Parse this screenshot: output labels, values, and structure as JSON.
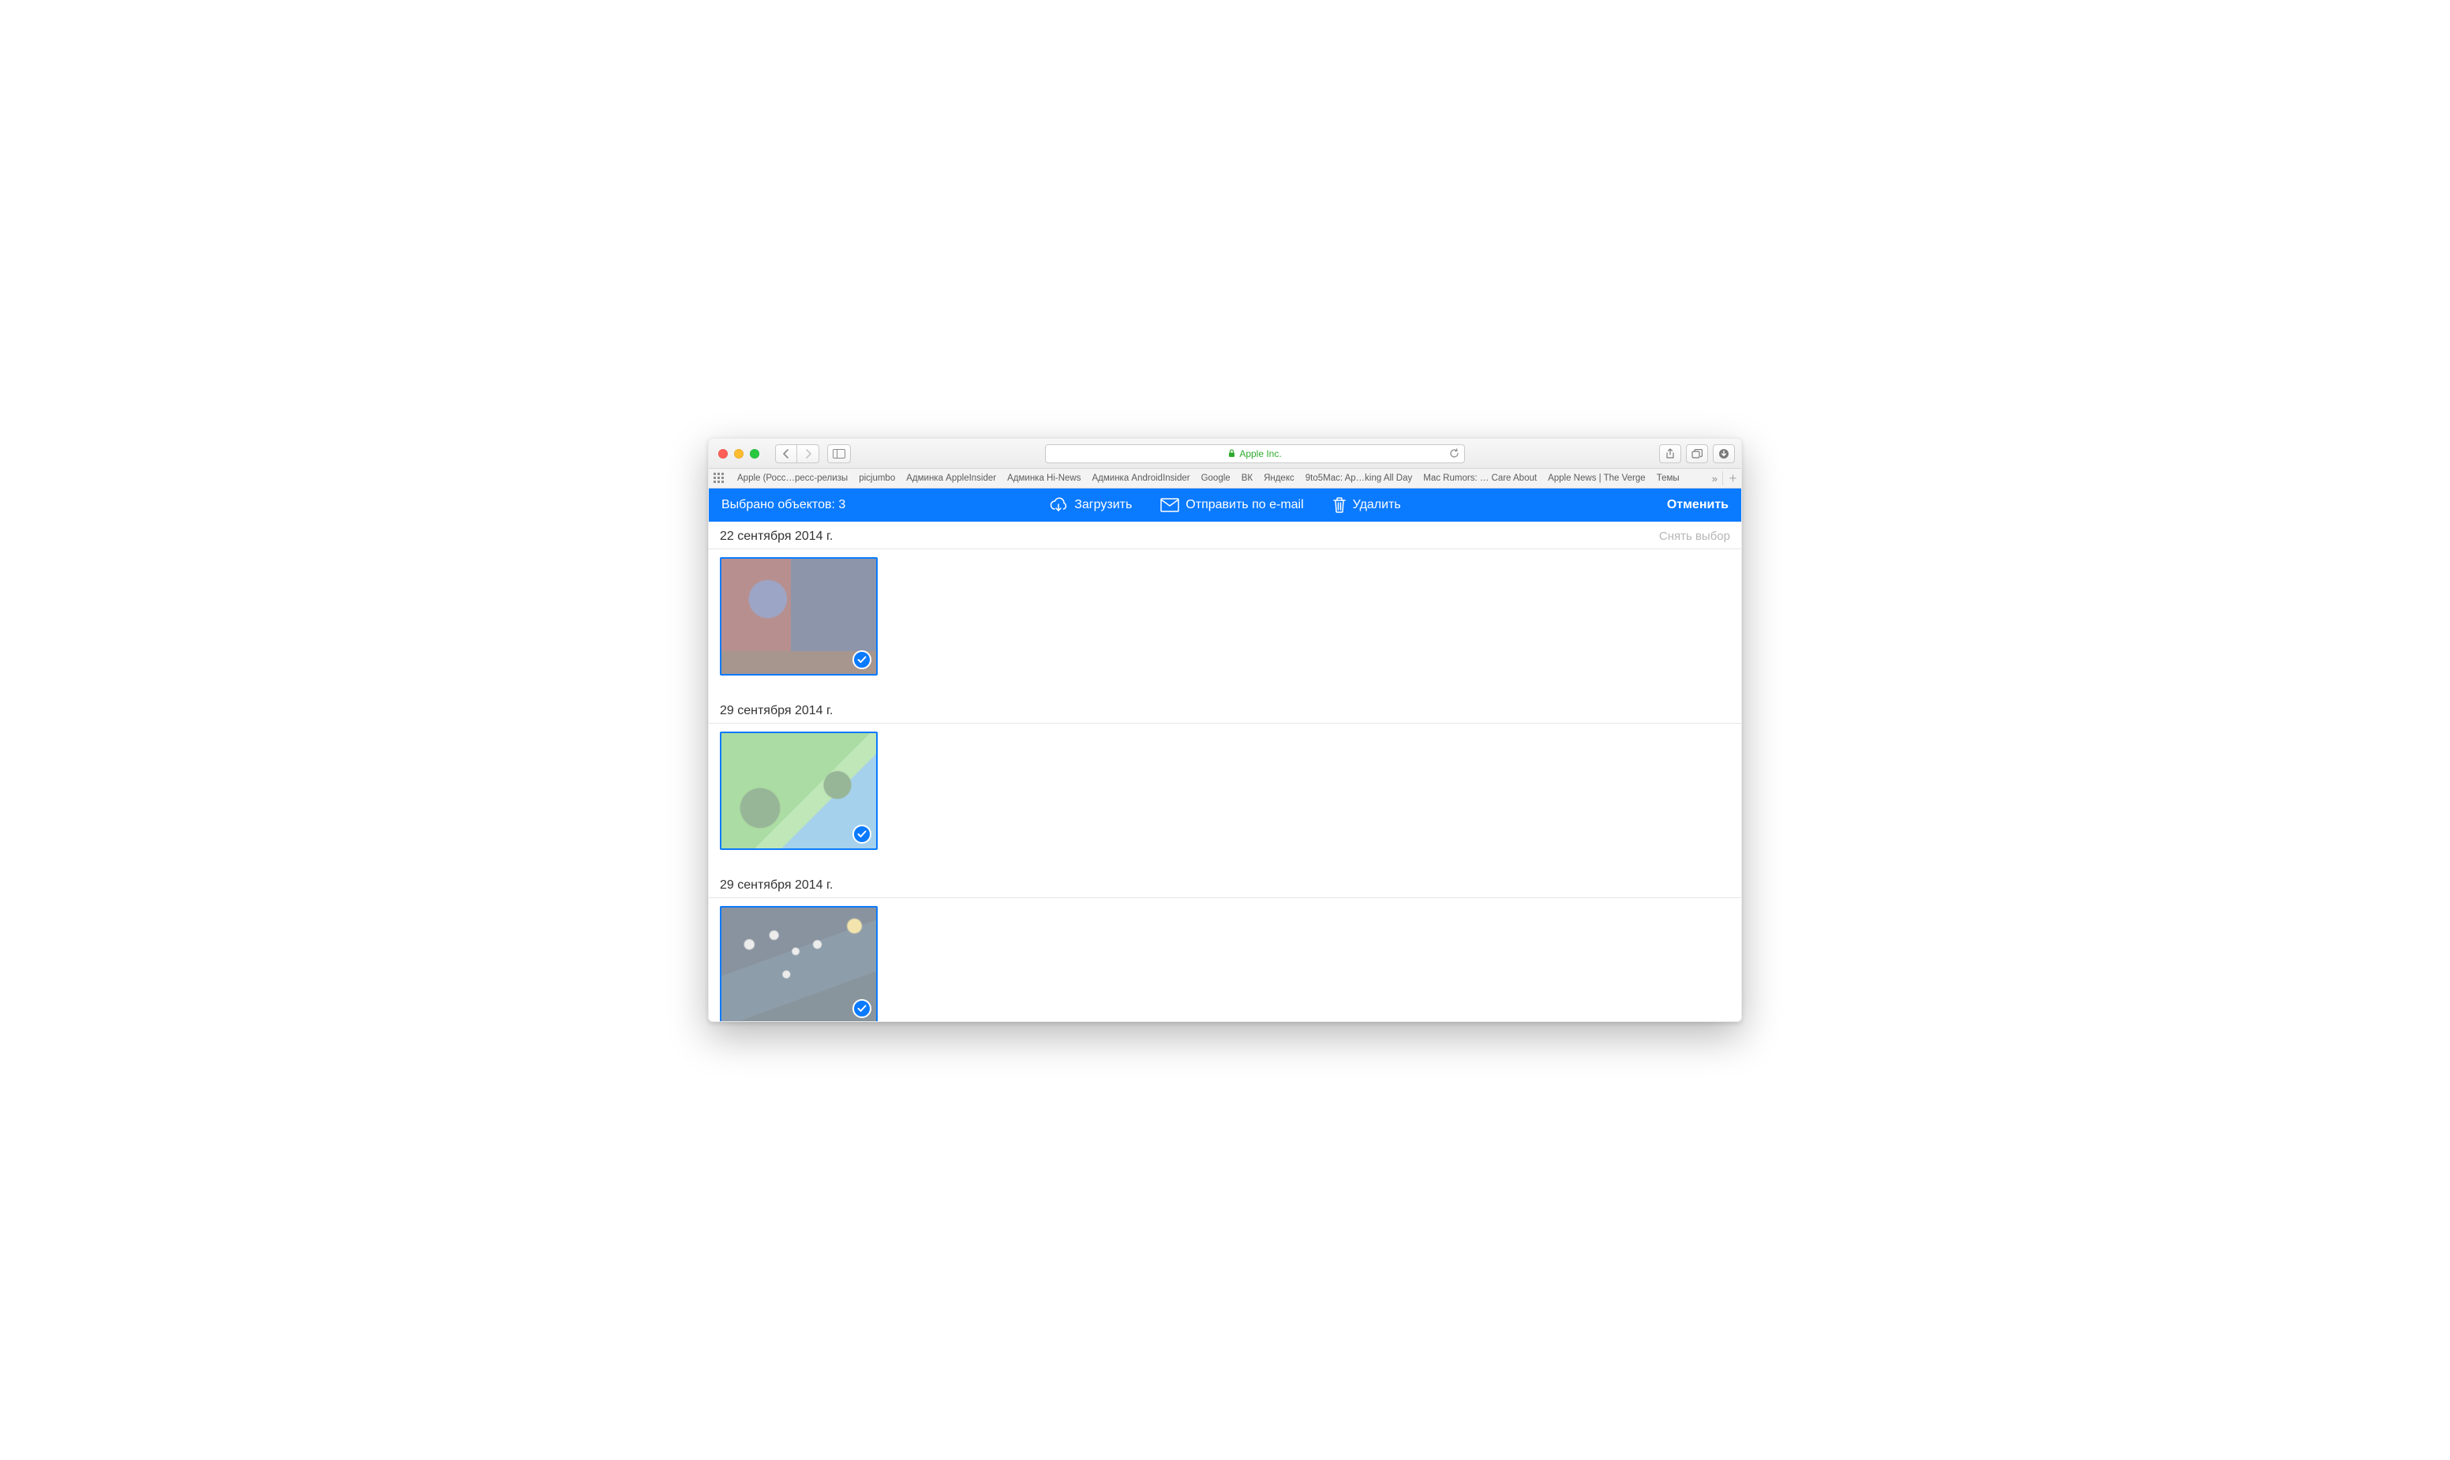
{
  "browser": {
    "url_label": "Apple Inc.",
    "favorites": [
      "Apple (Росс…ресс-релизы",
      "picjumbo",
      "Админка AppleInsider",
      "Админка Hi-News",
      "Админка AndroidInsider",
      "Google",
      "ВК",
      "Яндекс",
      "9to5Mac: Ap…king All Day",
      "Mac Rumors: … Care About",
      "Apple News | The Verge",
      "Темы"
    ]
  },
  "toolbar": {
    "selection_label": "Выбрано объектов: 3",
    "download_label": "Загрузить",
    "email_label": "Отправить по e-mail",
    "delete_label": "Удалить",
    "cancel_label": "Отменить"
  },
  "groups": [
    {
      "date": "22 сентября 2014 г.",
      "deselect_label": "Снять выбор",
      "thumb_class": "thumb-1"
    },
    {
      "date": "29 сентября 2014 г.",
      "deselect_label": "",
      "thumb_class": "thumb-2"
    },
    {
      "date": "29 сентября 2014 г.",
      "deselect_label": "",
      "thumb_class": "thumb-3"
    }
  ],
  "partial_next_date": ""
}
